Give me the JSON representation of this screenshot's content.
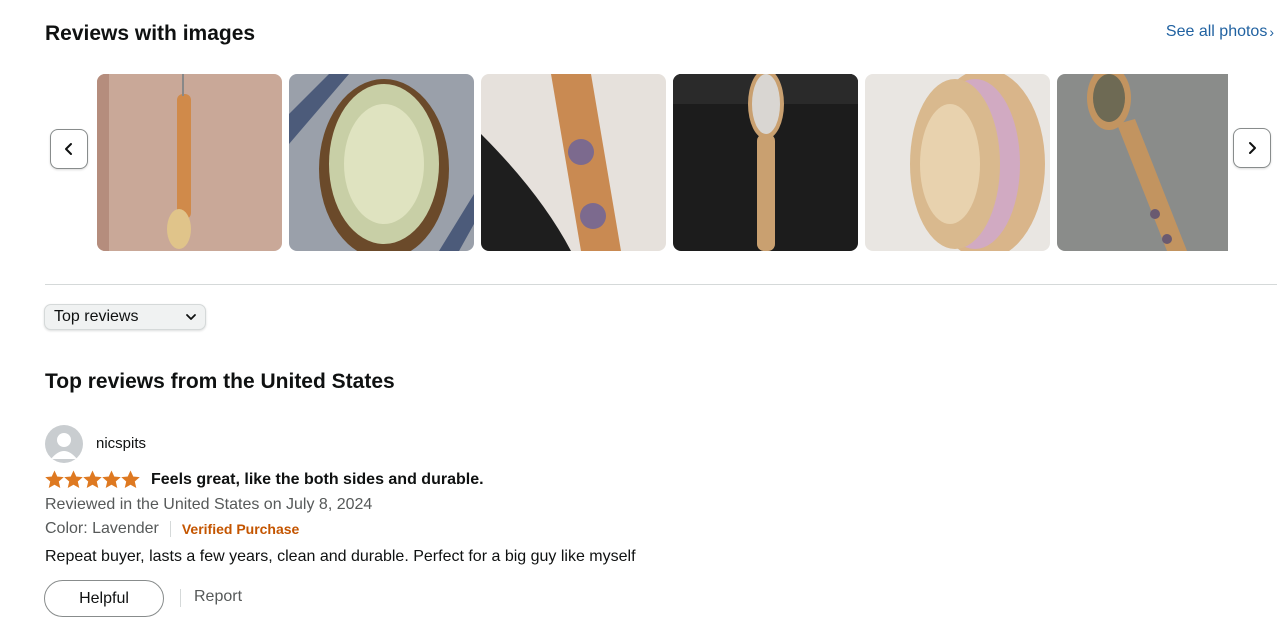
{
  "images_section": {
    "title": "Reviews with images",
    "see_all_label": "See all photos",
    "see_all_chevron": "›",
    "prev_icon": "chevron-left-icon",
    "next_icon": "chevron-right-icon"
  },
  "sort": {
    "selected": "Top reviews",
    "caret_icon": "chevron-down-icon"
  },
  "reviews_heading": "Top reviews from the United States",
  "review": {
    "reviewer": "nicspits",
    "rating": 5,
    "rating_max": 5,
    "title": "Feels great, like the both sides and durable.",
    "date_line": "Reviewed in the United States on July 8, 2024",
    "color_line": "Color: Lavender",
    "verified_label": "Verified Purchase",
    "body": "Repeat buyer, lasts a few years, clean and durable. Perfect for a big guy like myself",
    "helpful_label": "Helpful",
    "report_label": "Report"
  },
  "colors": {
    "link": "#2162a1",
    "star": "#de7921",
    "verified": "#c45500",
    "muted_text": "#565959"
  }
}
